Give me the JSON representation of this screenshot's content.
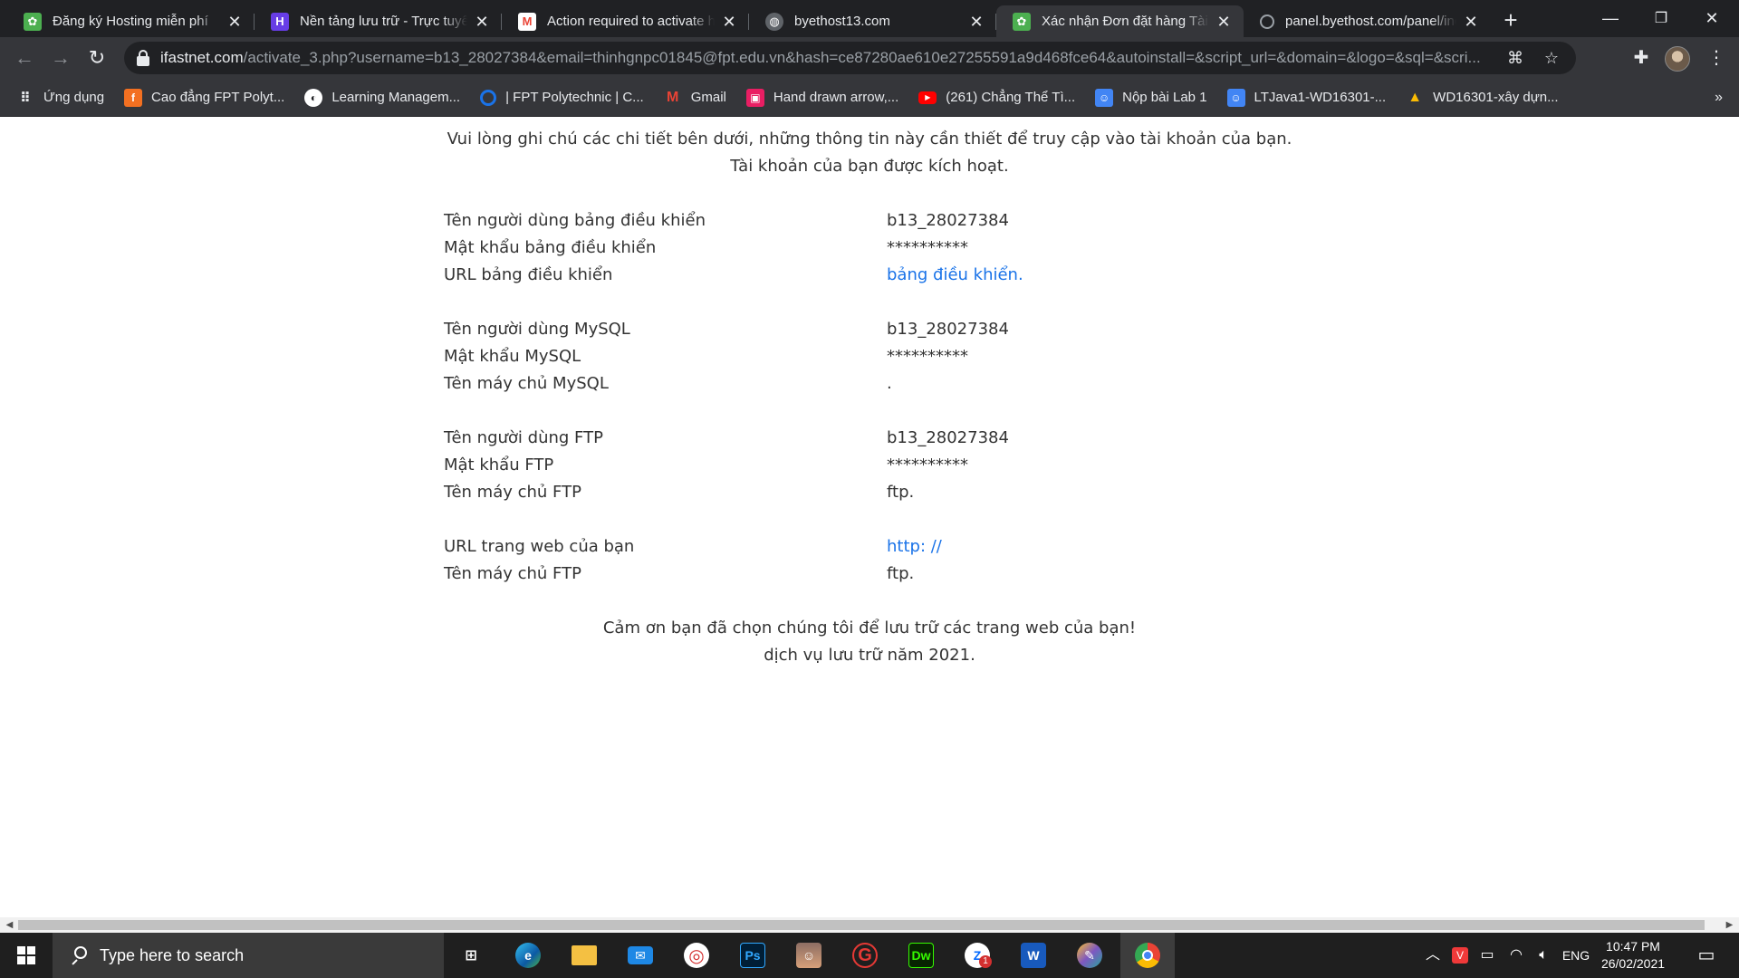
{
  "tabs": [
    {
      "title": "Đăng ký Hosting miễn phí",
      "icon": "leaf-favicon-icon",
      "color": "#4caf50"
    },
    {
      "title": "Nền tảng lưu trữ - Trực tuyến",
      "icon": "hostinger-favicon-icon",
      "color": "#673de6"
    },
    {
      "title": "Action required to activate hosting",
      "icon": "gmail-favicon-icon",
      "color": "#ea4335"
    },
    {
      "title": "byethost13.com",
      "icon": "globe-favicon-icon",
      "color": "#9aa0a6"
    },
    {
      "title": "Xác nhận Đơn đặt hàng Tài khoản",
      "icon": "leaf-favicon-icon",
      "color": "#4caf50"
    },
    {
      "title": "panel.byethost.com/panel/index",
      "icon": "loading-favicon-icon",
      "color": "#9aa0a6"
    }
  ],
  "address": {
    "host": "ifastnet.com",
    "path": "/activate_3.php?username=b13_28027384&email=thinhgnpc01845@fpt.edu.vn&hash=ce87280ae610e27255591a9d468fce64&autoinstall=&script_url=&domain=&logo=&sql=&scri..."
  },
  "bookmarks": [
    {
      "label": "Ứng dụng",
      "icon": "apps-grid-icon",
      "color": "#4285f4"
    },
    {
      "label": "Cao đẳng FPT Polyt...",
      "icon": "fpt-logo-icon",
      "color": "#f37021"
    },
    {
      "label": "Learning Managem...",
      "icon": "lms-logo-icon",
      "color": "#ffffff"
    },
    {
      "label": "| FPT Polytechnic | C...",
      "icon": "circle-logo-icon",
      "color": "#1a73e8"
    },
    {
      "label": "Gmail",
      "icon": "gmail-icon",
      "color": "#ea4335"
    },
    {
      "label": "Hand drawn arrow,...",
      "icon": "freepik-icon",
      "color": "#e91e63"
    },
    {
      "label": "(261) Chẳng Thể Tì...",
      "icon": "youtube-icon",
      "color": "#ff0000"
    },
    {
      "label": "Nộp bài Lab 1",
      "icon": "classroom-icon",
      "color": "#4285f4"
    },
    {
      "label": "LTJava1-WD16301-...",
      "icon": "classroom-icon",
      "color": "#4285f4"
    },
    {
      "label": "WD16301-xây dựn...",
      "icon": "drive-icon",
      "color": "#fbbc04"
    }
  ],
  "content": {
    "intro_line1": "Vui lòng ghi chú các chi tiết bên dưới, những thông tin này cần thiết để truy cập vào tài khoản của bạn.",
    "intro_line2": "Tài khoản của bạn được kích hoạt.",
    "cp_user_label": "Tên người dùng bảng điều khiển",
    "cp_user_value": "b13_28027384",
    "cp_pass_label": "Mật khẩu bảng điều khiển",
    "cp_pass_value": "**********",
    "cp_url_label": "URL bảng điều khiển",
    "cp_url_value": "bảng điều khiển.",
    "mysql_user_label": "Tên người dùng MySQL",
    "mysql_user_value": "b13_28027384",
    "mysql_pass_label": "Mật khẩu MySQL",
    "mysql_pass_value": "**********",
    "mysql_host_label": "Tên máy chủ MySQL",
    "mysql_host_value": ".",
    "ftp_user_label": "Tên người dùng FTP",
    "ftp_user_value": "b13_28027384",
    "ftp_pass_label": "Mật khẩu FTP",
    "ftp_pass_value": "**********",
    "ftp_host_label": "Tên máy chủ FTP",
    "ftp_host_value": "ftp.",
    "site_url_label": "URL trang web của bạn",
    "site_url_value": "http: //",
    "ftp_host2_label": "Tên máy chủ FTP",
    "ftp_host2_value": "ftp.",
    "thanks_line1": "Cảm ơn bạn đã chọn chúng tôi để lưu trữ các trang web của bạn!",
    "thanks_line2": "dịch vụ lưu trữ năm 2021."
  },
  "taskbar": {
    "search_placeholder": "Type here to search",
    "apps": [
      {
        "name": "task-view-icon",
        "glyph": "▮▯",
        "color": "#1f1f1f"
      },
      {
        "name": "edge-icon",
        "glyph": "e",
        "color": "#0c8ad6"
      },
      {
        "name": "file-explorer-icon",
        "glyph": "▬",
        "color": "#f4c042"
      },
      {
        "name": "mail-icon",
        "glyph": "✉",
        "color": "#1e88e5"
      },
      {
        "name": "app-red-ring-icon",
        "glyph": "◎",
        "color": "#d32f2f"
      },
      {
        "name": "photoshop-icon",
        "glyph": "Ps",
        "color": "#001e36"
      },
      {
        "name": "game-avatar-icon",
        "glyph": "☺",
        "color": "#8d6e63"
      },
      {
        "name": "garena-icon",
        "glyph": "G",
        "color": "#c62828"
      },
      {
        "name": "dreamweaver-icon",
        "glyph": "Dw",
        "color": "#35fa00"
      },
      {
        "name": "zalo-icon",
        "glyph": "Z",
        "color": "#0068ff"
      },
      {
        "name": "word-icon",
        "glyph": "W",
        "color": "#185abd"
      },
      {
        "name": "paint-icon",
        "glyph": "✎",
        "color": "#7e57c2"
      },
      {
        "name": "chrome-icon",
        "glyph": "◉",
        "color": "#34a853"
      }
    ],
    "zalo_badge": "1",
    "language": "ENG",
    "time": "10:47 PM",
    "date": "26/02/2021"
  }
}
